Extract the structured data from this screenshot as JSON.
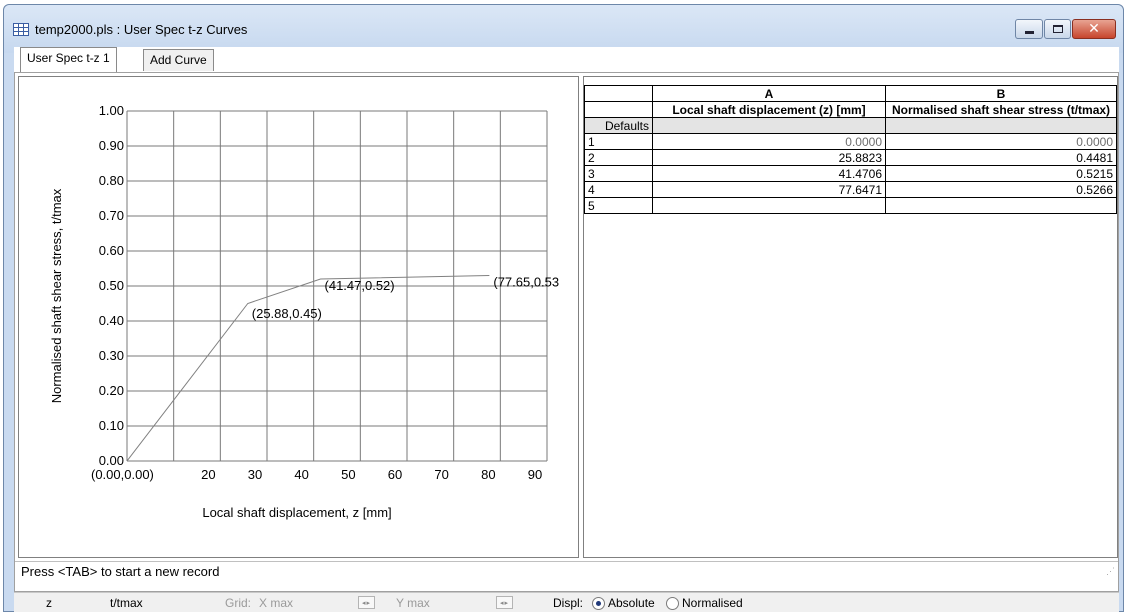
{
  "window": {
    "title": "temp2000.pls : User Spec t-z Curves",
    "controls": {
      "minimize": "minimize-icon",
      "maximize": "maximize-icon",
      "close": "close-icon"
    }
  },
  "tabs": [
    {
      "label": "User Spec t-z 1",
      "active": true
    },
    {
      "label": "Add Curve",
      "active": false
    }
  ],
  "chart_data": {
    "type": "line",
    "xlabel": "Local shaft displacement, z [mm]",
    "ylabel": "Normalised shaft shear stress, t/tmax",
    "xlim": [
      0,
      90
    ],
    "ylim": [
      0,
      1.0
    ],
    "x_ticks": [
      "(0.00,0.00)",
      "20",
      "30",
      "40",
      "50",
      "60",
      "70",
      "80",
      "90"
    ],
    "x_tick_values": [
      0,
      20,
      30,
      40,
      50,
      60,
      70,
      80,
      90
    ],
    "y_ticks": [
      "0.00",
      "0.10",
      "0.20",
      "0.30",
      "0.40",
      "0.50",
      "0.60",
      "0.70",
      "0.80",
      "0.90",
      "1.00"
    ],
    "y_tick_values": [
      0,
      0.1,
      0.2,
      0.3,
      0.4,
      0.5,
      0.6,
      0.7,
      0.8,
      0.9,
      1.0
    ],
    "grid": true,
    "series": [
      {
        "x": [
          0,
          25.88,
          41.47,
          77.65
        ],
        "y": [
          0,
          0.45,
          0.52,
          0.53
        ]
      }
    ],
    "annotations": [
      "(25.88,0.45)",
      "(41.47,0.52)",
      "(77.65,0.53"
    ],
    "line_color": "#808080"
  },
  "table": {
    "columns": [
      "A",
      "B"
    ],
    "headers": [
      "Local shaft displacement (z) [mm]",
      "Normalised shaft shear stress (t/tmax)"
    ],
    "defaults_label": "Defaults",
    "rows": [
      {
        "label": "1",
        "a": "0.0000",
        "b": "0.0000"
      },
      {
        "label": "2",
        "a": "25.8823",
        "b": "0.4481"
      },
      {
        "label": "3",
        "a": "41.4706",
        "b": "0.5215"
      },
      {
        "label": "4",
        "a": "77.6471",
        "b": "0.5266"
      },
      {
        "label": "5",
        "a": "",
        "b": ""
      }
    ]
  },
  "status": {
    "message": "Press <TAB> to start a new record"
  },
  "bottombar": {
    "z": "z",
    "t": "t/tmax",
    "grid": "Grid:",
    "xmax": "X max",
    "ymax": "Y max",
    "displ": "Displ:",
    "absolute": "Absolute",
    "normalised": "Normalised",
    "selected": "Absolute"
  }
}
